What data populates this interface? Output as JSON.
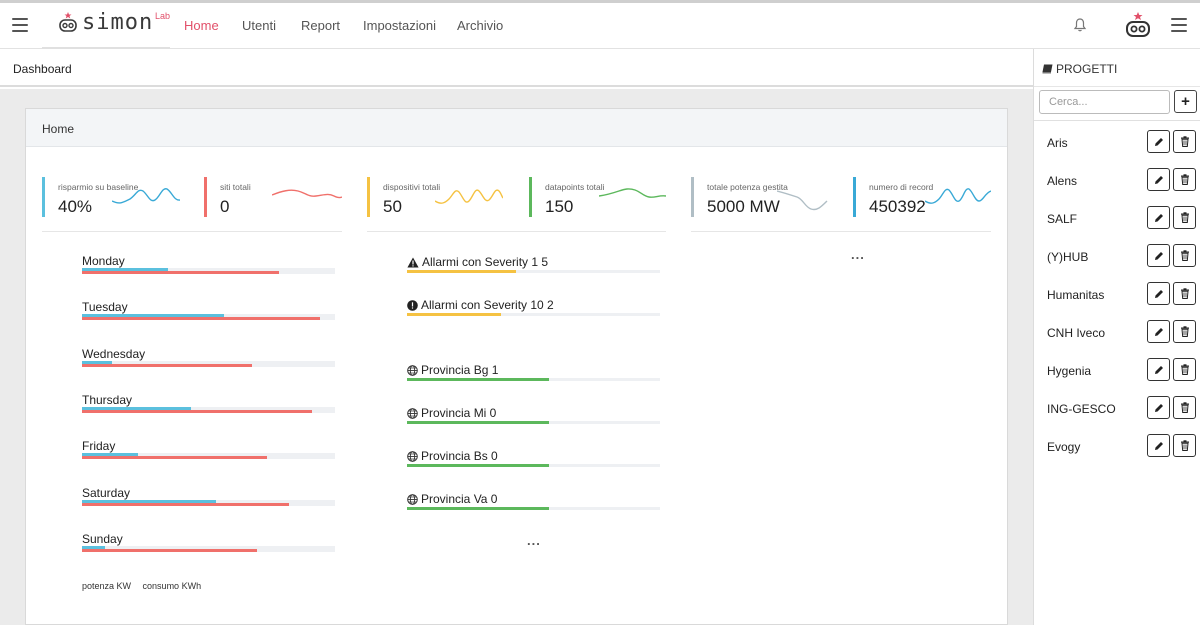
{
  "app": {
    "logo_text": "simon",
    "logo_sup": "Lab",
    "brand_color": "#e2506a"
  },
  "nav": {
    "items": [
      {
        "label": "Home",
        "active": true
      },
      {
        "label": "Utenti"
      },
      {
        "label": "Report"
      },
      {
        "label": "Impostazioni"
      },
      {
        "label": "Archivio"
      }
    ]
  },
  "icons": [
    "menu-icon",
    "robot-logo-icon",
    "bell-icon",
    "user-avatar-icon",
    "warning-icon",
    "exclamation-circle-icon",
    "globe-icon",
    "book-icon",
    "plus-icon",
    "pencil-icon",
    "trash-icon"
  ],
  "breadcrumb": "Dashboard",
  "card": {
    "title": "Home"
  },
  "kpis": [
    {
      "label": "risparmio su baseline",
      "value": "40%",
      "color": "#5bc0de"
    },
    {
      "label": "siti totali",
      "value": "0",
      "color": "#f0706b"
    },
    {
      "label": "dispositivi totali",
      "value": "50",
      "color": "#f5c242"
    },
    {
      "label": "datapoints totali",
      "value": "150",
      "color": "#5cb85c"
    },
    {
      "label": "totale potenza gestita",
      "value": "5000 MW",
      "color": "#b0bec5"
    },
    {
      "label": "numero di record",
      "value": "450392",
      "color": "#39a9d6"
    }
  ],
  "chart_data": {
    "type": "bar",
    "categories": [
      "Monday",
      "Tuesday",
      "Wednesday",
      "Thursday",
      "Friday",
      "Saturday",
      "Sunday"
    ],
    "series": [
      {
        "name": "potenza KW",
        "color": "#5bc0de",
        "values": [
          34,
          56,
          12,
          43,
          22,
          53,
          9
        ]
      },
      {
        "name": "consumo KWh",
        "color": "#f0706b",
        "values": [
          78,
          94,
          67,
          91,
          73,
          82,
          69
        ]
      }
    ],
    "ylim": [
      0,
      100
    ]
  },
  "legend": [
    "potenza KW",
    "consumo KWh"
  ],
  "alarms": [
    {
      "label": "Allarmi con Severity 1 5",
      "icon": "warning-icon",
      "fraction": 0.43,
      "color": "#f5c242"
    },
    {
      "label": "Allarmi con Severity 10 2",
      "icon": "exclamation-circle-icon",
      "fraction": 0.37,
      "color": "#f5c242"
    }
  ],
  "provinces": [
    {
      "label": "Provincia Bg 1",
      "fraction": 0.56,
      "color": "#5cb85c"
    },
    {
      "label": "Provincia Mi 0",
      "fraction": 0.56,
      "color": "#5cb85c"
    },
    {
      "label": "Provincia Bs 0",
      "fraction": 0.56,
      "color": "#5cb85c"
    },
    {
      "label": "Provincia Va 0",
      "fraction": 0.56,
      "color": "#5cb85c"
    }
  ],
  "more": "...",
  "sidebar": {
    "title": "PROGETTI",
    "search_placeholder": "Cerca...",
    "projects": [
      "Aris",
      "Alens",
      "SALF",
      "(Y)HUB",
      "Humanitas",
      "CNH Iveco",
      "Hygenia",
      "ING-GESCO",
      "Evogy"
    ]
  }
}
